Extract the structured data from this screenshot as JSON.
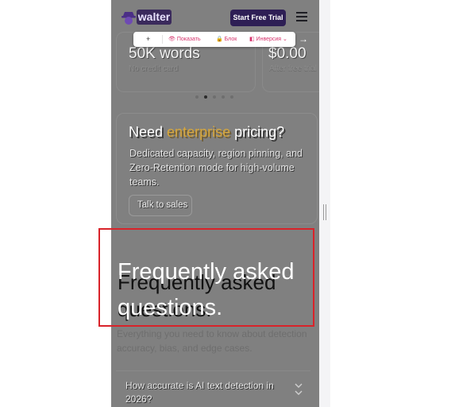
{
  "header": {
    "logo_text": "walter",
    "cta_label": "Start Free Trial",
    "menu_icon": "hamburger-icon"
  },
  "toolbar": {
    "add_label": "+",
    "show_label": "👁 Показать",
    "block_label": "🔒 Блок",
    "invert_label": "◧ Инверсия ⌄"
  },
  "pricing": {
    "card1": {
      "amount": "50K words",
      "note": "No credit card"
    },
    "card2": {
      "amount": "$0.00",
      "note": "After free trial"
    },
    "next_arrow": "→"
  },
  "carousel": {
    "active_index": 1,
    "count": 5
  },
  "enterprise": {
    "title_before": "Need ",
    "title_accent": "enterprise",
    "title_after": " pricing?",
    "description": "Dedicated capacity, region pinning, and Zero-Retention mode for high-volume teams.",
    "button_label": "Talk to sales"
  },
  "faq": {
    "heading": "Frequently asked questions.",
    "subtitle": "Everything you need to know about detection accuracy, bias, and edge cases.",
    "items": [
      {
        "question": "How accurate is AI text detection in 2026?"
      }
    ]
  },
  "colors": {
    "brand": "#2e1f55",
    "accent": "#d8a73a",
    "toolbar_accent": "#d6336c",
    "highlight": "#d9232a"
  }
}
